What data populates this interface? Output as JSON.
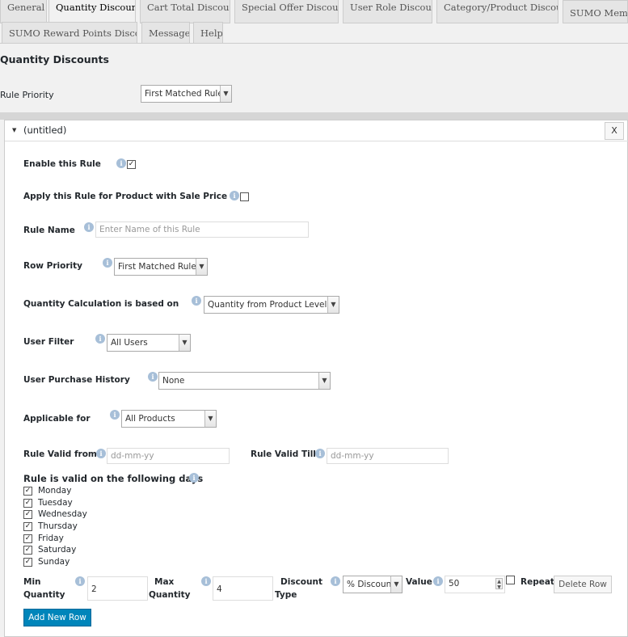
{
  "tabs": {
    "row1": [
      "General",
      "Quantity Discounts",
      "Cart Total Discounts",
      "Special Offer Discounts",
      "User Role Discounts",
      "Category/Product Discounts",
      "SUMO Member"
    ],
    "row2": [
      "SUMO Reward Points Discounts",
      "Message",
      "Help"
    ],
    "active": "Quantity Discounts"
  },
  "page": {
    "title": "Quantity Discounts",
    "rule_priority_label": "Rule Priority",
    "rule_priority_value": "First Matched Rule"
  },
  "panel": {
    "title": "(untitled)",
    "close_label": "X",
    "enable_label": "Enable this Rule",
    "sale_price_label": "Apply this Rule for Product with Sale Price",
    "rule_name_label": "Rule Name",
    "rule_name_placeholder": "Enter Name of this Rule",
    "row_priority_label": "Row Priority",
    "row_priority_value": "First Matched Rule",
    "qty_calc_label": "Quantity Calculation is based on",
    "qty_calc_value": "Quantity from Product Level",
    "user_filter_label": "User Filter",
    "user_filter_value": "All Users",
    "purchase_history_label": "User Purchase History",
    "purchase_history_value": "None",
    "applicable_label": "Applicable for",
    "applicable_value": "All Products",
    "valid_from_label": "Rule Valid from",
    "valid_from_placeholder": "dd-mm-yy",
    "valid_till_label": "Rule Valid Till",
    "valid_till_placeholder": "dd-mm-yy",
    "days_heading": "Rule is valid on the following days",
    "days": [
      "Monday",
      "Tuesday",
      "Wednesday",
      "Thursday",
      "Friday",
      "Saturday",
      "Sunday"
    ],
    "min_label_1": "Min",
    "min_label_2": "Quantity",
    "min_value": "2",
    "max_label_1": "Max",
    "max_label_2": "Quantity",
    "max_value": "4",
    "dtype_label_1": "Discount",
    "dtype_label_2": "Type",
    "dtype_value": "% Discount",
    "value_label": "Value",
    "value_value": "50",
    "repeat_label": "Repeat",
    "delete_label": "Delete Row",
    "add_label": "Add New Row"
  },
  "icons": {
    "info": "info-icon",
    "check": "✓",
    "caret": "▼",
    "arrow": "▼"
  },
  "colors": {
    "primary_button": "#0085ba",
    "info_icon": "#a7bfd8"
  }
}
